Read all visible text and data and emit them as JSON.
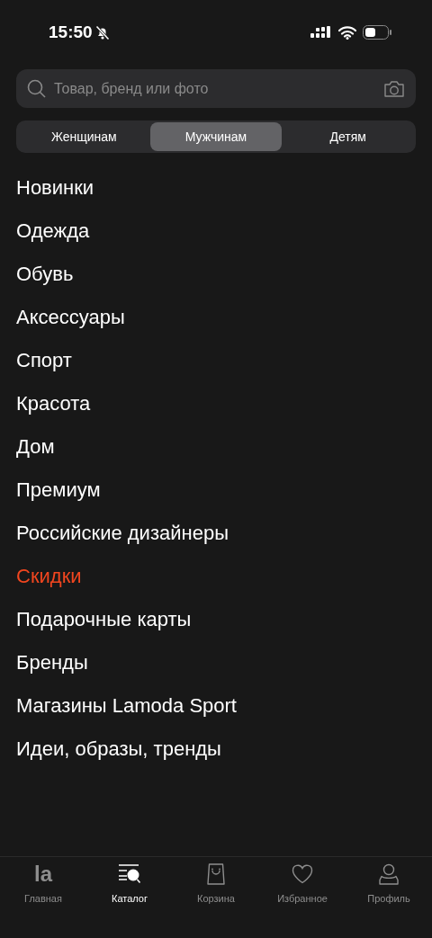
{
  "status_bar": {
    "time": "15:50",
    "silent": true
  },
  "search": {
    "placeholder": "Товар, бренд или фото"
  },
  "segments": [
    {
      "label": "Женщинам",
      "selected": false
    },
    {
      "label": "Мужчинам",
      "selected": true
    },
    {
      "label": "Детям",
      "selected": false
    }
  ],
  "categories": [
    {
      "label": "Новинки",
      "highlighted": false
    },
    {
      "label": "Одежда",
      "highlighted": false
    },
    {
      "label": "Обувь",
      "highlighted": false
    },
    {
      "label": "Аксессуары",
      "highlighted": false
    },
    {
      "label": "Спорт",
      "highlighted": false
    },
    {
      "label": "Красота",
      "highlighted": false
    },
    {
      "label": "Дом",
      "highlighted": false
    },
    {
      "label": "Премиум",
      "highlighted": false
    },
    {
      "label": "Российские дизайнеры",
      "highlighted": false
    },
    {
      "label": "Скидки",
      "highlighted": true
    },
    {
      "label": "Подарочные карты",
      "highlighted": false
    },
    {
      "label": "Бренды",
      "highlighted": false
    },
    {
      "label": "Магазины Lamoda Sport",
      "highlighted": false
    },
    {
      "label": "Идеи, образы, тренды",
      "highlighted": false
    }
  ],
  "tab_bar": [
    {
      "kind": "home",
      "logo": "la",
      "label": "Главная",
      "selected": false
    },
    {
      "kind": "catalog",
      "label": "Каталог",
      "selected": true
    },
    {
      "kind": "cart",
      "label": "Корзина",
      "selected": false
    },
    {
      "kind": "favorites",
      "label": "Избранное",
      "selected": false
    },
    {
      "kind": "profile",
      "label": "Профиль",
      "selected": false
    }
  ]
}
